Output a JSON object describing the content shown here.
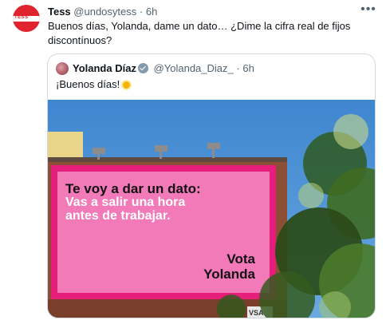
{
  "tweet": {
    "author_name": "Tess",
    "handle": "@undosytess",
    "separator": "·",
    "time": "6h",
    "text": "Buenos días, Yolanda, dame un dato… ¿Dime la cifra real de fijos discontínuos?",
    "avatar_text": "TESS",
    "more_label": "•••"
  },
  "quote": {
    "author_name": "Yolanda Díaz",
    "handle": "@Yolanda_Diaz_",
    "separator": "·",
    "time": "6h",
    "text": "¡Buenos días!",
    "billboard": {
      "line1": "Te voy a dar un dato:",
      "line2": "Vas a salir una hora",
      "line3": "antes de trabajar.",
      "vote_line1": "Vota",
      "vote_line2": "Yolanda",
      "sign": "VSA"
    }
  },
  "colors": {
    "billboard_pink": "#f27ab8",
    "billboard_frame": "#e51e7b",
    "sky": "#4d8fd0",
    "brick": "#9c5a3d",
    "tess_red": "#e0242f"
  }
}
